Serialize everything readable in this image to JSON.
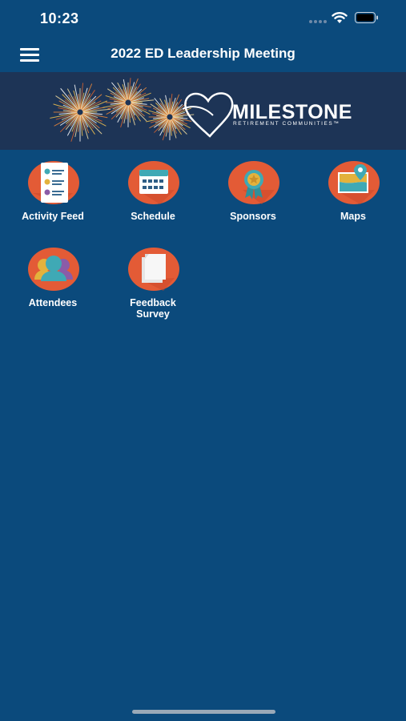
{
  "status": {
    "time": "10:23"
  },
  "nav": {
    "title": "2022 ED Leadership Meeting"
  },
  "banner": {
    "brand_name": "MILESTONE",
    "brand_tagline": "RETIREMENT COMMUNITIES™"
  },
  "tiles": [
    {
      "label": "Activity Feed",
      "icon": "activity-feed-icon"
    },
    {
      "label": "Schedule",
      "icon": "calendar-icon"
    },
    {
      "label": "Sponsors",
      "icon": "award-ribbon-icon"
    },
    {
      "label": "Maps",
      "icon": "map-pin-icon"
    },
    {
      "label": "Attendees",
      "icon": "people-icon"
    },
    {
      "label": "Feedback\nSurvey",
      "icon": "documents-icon"
    }
  ],
  "colors": {
    "background": "#0b4a7c",
    "banner": "#1d3456",
    "icon_circle": "#e35b36"
  }
}
